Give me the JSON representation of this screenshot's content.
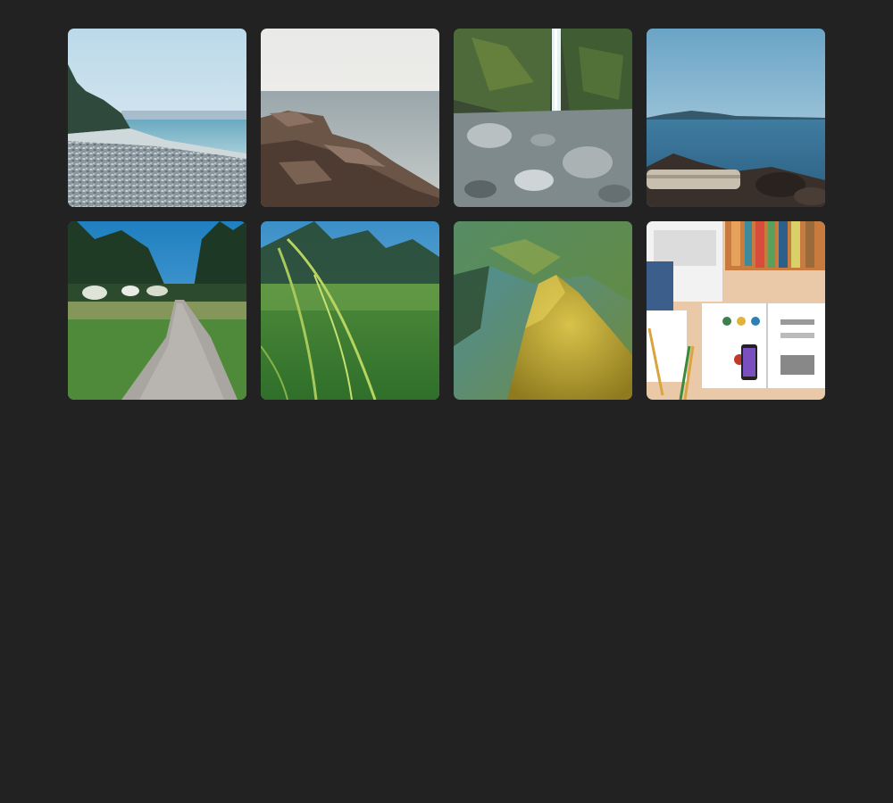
{
  "gallery": {
    "tiles": [
      {
        "subject": "pebble-beach-with-trees"
      },
      {
        "subject": "rocky-shore-calm-sea"
      },
      {
        "subject": "waterfall-rocky-gorge"
      },
      {
        "subject": "lake-with-driftwood-rocks"
      },
      {
        "subject": "gravel-path-through-park"
      },
      {
        "subject": "grass-blades-closeup"
      },
      {
        "subject": "mossy-branch-closeup"
      },
      {
        "subject": "desk-with-laptop-books"
      }
    ]
  }
}
